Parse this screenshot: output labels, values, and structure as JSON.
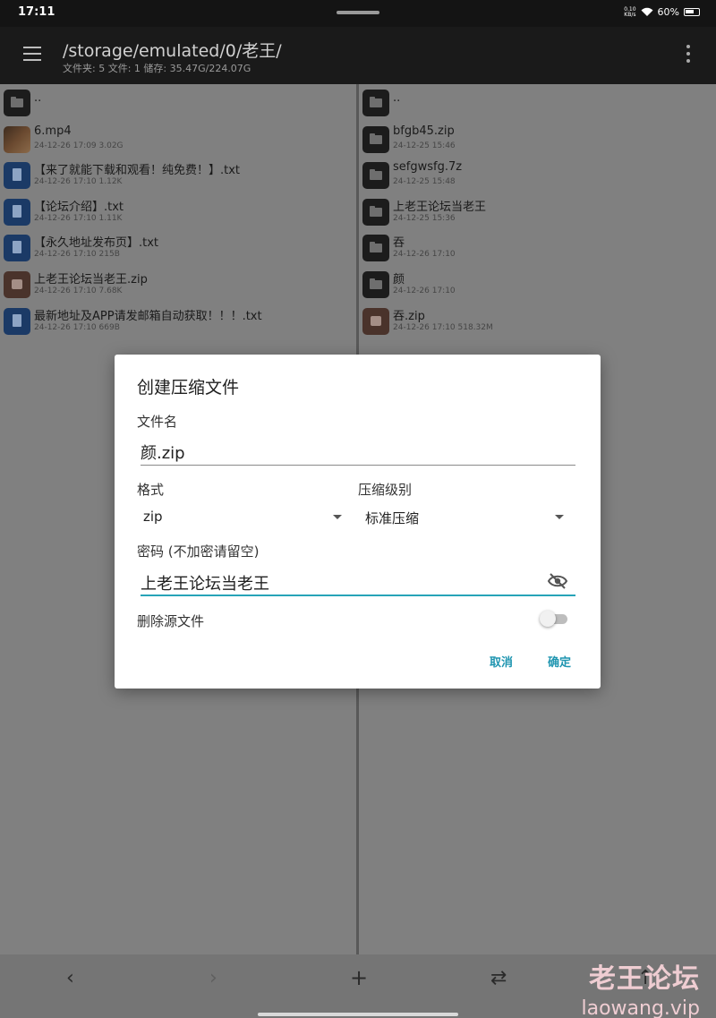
{
  "status": {
    "time": "17:11",
    "net_speed_value": "0.10",
    "net_speed_unit": "KB/s",
    "battery": "60%"
  },
  "app_bar": {
    "path": "/storage/emulated/0/老王/",
    "summary": "文件夹: 5  文件: 1  储存: 35.47G/224.07G"
  },
  "left_pane": {
    "parent": "..",
    "items": [
      {
        "name": "6.mp4",
        "meta": "24-12-26 17:09  3.02G",
        "icon": "video-thumbnail"
      },
      {
        "name": "【来了就能下载和观看！纯免费！】.txt",
        "meta": "24-12-26 17:10  1.12K",
        "icon": "text-file-icon"
      },
      {
        "name": "【论坛介绍】.txt",
        "meta": "24-12-26 17:10  1.11K",
        "icon": "text-file-icon"
      },
      {
        "name": "【永久地址发布页】.txt",
        "meta": "24-12-26 17:10  215B",
        "icon": "text-file-icon"
      },
      {
        "name": "上老王论坛当老王.zip",
        "meta": "24-12-26 17:10  7.68K",
        "icon": "archive-icon"
      },
      {
        "name": "最新地址及APP请发邮箱自动获取！！！.txt",
        "meta": "24-12-26 17:10  669B",
        "icon": "text-file-icon"
      }
    ]
  },
  "right_pane": {
    "parent": "..",
    "items": [
      {
        "name": "bfgb45.zip",
        "meta": "24-12-25 15:46",
        "icon": "folder-icon"
      },
      {
        "name": "sefgwsfg.7z",
        "meta": "24-12-25 15:48",
        "icon": "folder-icon"
      },
      {
        "name": "上老王论坛当老王",
        "meta": "24-12-25 15:36",
        "icon": "folder-icon"
      },
      {
        "name": "吞",
        "meta": "24-12-26 17:10",
        "icon": "folder-icon"
      },
      {
        "name": "颜",
        "meta": "24-12-26 17:10",
        "icon": "folder-icon"
      },
      {
        "name": "吞.zip",
        "meta": "24-12-26 17:10  518.32M",
        "icon": "archive-icon"
      }
    ]
  },
  "dialog": {
    "title": "创建压缩文件",
    "filename_label": "文件名",
    "filename_value": "颜.zip",
    "format_label": "格式",
    "format_value": "zip",
    "level_label": "压缩级别",
    "level_value": "标准压缩",
    "password_label": "密码 (不加密请留空)",
    "password_value": "上老王论坛当老王",
    "delete_source_label": "删除源文件",
    "delete_source_on": false,
    "cancel_label": "取消",
    "ok_label": "确定"
  },
  "bottom_bar": {
    "back": "‹",
    "forward": "›",
    "add": "+",
    "swap": "⇄",
    "up": "↑"
  },
  "watermark": {
    "title": "老王论坛",
    "url": "laowang.vip"
  },
  "colors": {
    "accent": "#27a3b8",
    "button_text": "#1f95b0",
    "dim_overlay": "#808080"
  }
}
